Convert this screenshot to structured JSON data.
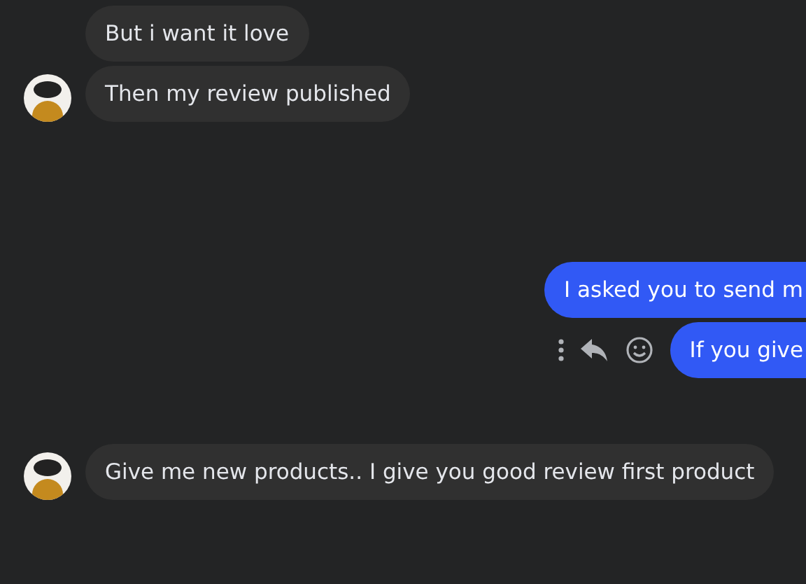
{
  "messages": [
    {
      "kind": "received",
      "text": "But i want it love",
      "avatar": false,
      "actions": false
    },
    {
      "kind": "received",
      "text": "Then my review published",
      "avatar": true,
      "actions": false
    },
    {
      "kind": "sent",
      "text": "I asked you to send m",
      "avatar": false,
      "actions": false
    },
    {
      "kind": "sent",
      "text": "If you give",
      "avatar": false,
      "actions": true
    },
    {
      "kind": "received",
      "text": "Give me new products.. I give you good review first product",
      "avatar": true,
      "actions": false
    }
  ]
}
